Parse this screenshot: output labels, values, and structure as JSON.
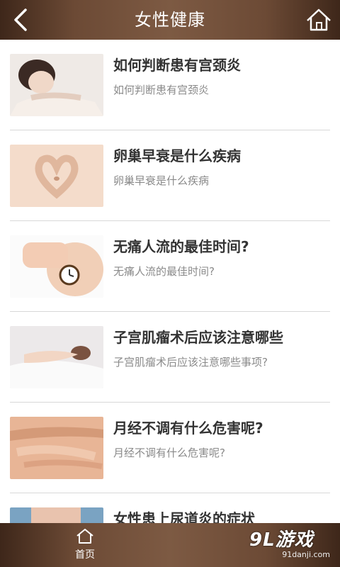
{
  "header": {
    "title": "女性健康"
  },
  "articles": [
    {
      "title": "如何判断患有宫颈炎",
      "subtitle": "如何判断患有宫颈炎"
    },
    {
      "title": "卵巢早衰是什么疾病",
      "subtitle": "卵巢早衰是什么疾病"
    },
    {
      "title": "无痛人流的最佳时间?",
      "subtitle": "无痛人流的最佳时间?"
    },
    {
      "title": "子宫肌瘤术后应该注意哪些",
      "subtitle": "子宫肌瘤术后应该注意哪些事项?"
    },
    {
      "title": "月经不调有什么危害呢?",
      "subtitle": "月经不调有什么危害呢?"
    },
    {
      "title": "女性患上尿道炎的症状",
      "subtitle": ""
    }
  ],
  "bottom_nav": {
    "home_label": "首页"
  },
  "watermark": {
    "logo": "9L游戏",
    "url": "91danji.com"
  },
  "colors": {
    "bar": "#6c4a35",
    "title_text": "#333333",
    "sub_text": "#8a8a8a"
  }
}
